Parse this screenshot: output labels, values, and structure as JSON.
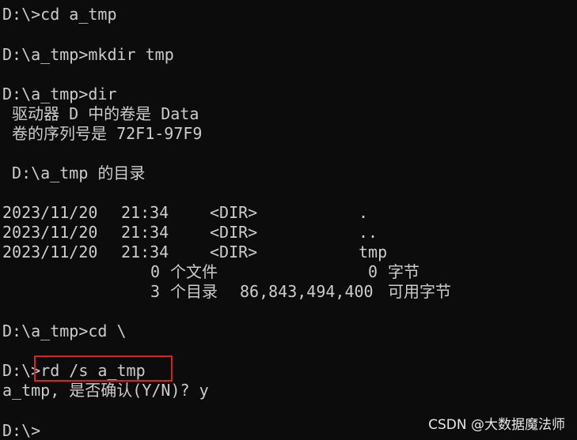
{
  "console": {
    "cmd1": "D:\\>cd a_tmp",
    "cmd2": "D:\\a_tmp>mkdir tmp",
    "cmd3": "D:\\a_tmp>dir",
    "volume_line": " 驱动器 D 中的卷是 Data",
    "serial_line": " 卷的序列号是 72F1-97F9",
    "dir_of_line": " D:\\a_tmp 的目录",
    "entries": [
      {
        "date": "2023/11/20",
        "time": "21:34",
        "type": "<DIR>",
        "name": "."
      },
      {
        "date": "2023/11/20",
        "time": "21:34",
        "type": "<DIR>",
        "name": ".."
      },
      {
        "date": "2023/11/20",
        "time": "21:34",
        "type": "<DIR>",
        "name": "tmp"
      }
    ],
    "files_summary": {
      "count": "0",
      "label": "个文件",
      "bytes": "0",
      "bytes_label": "字节"
    },
    "dirs_summary": {
      "count": "3",
      "label": "个目录",
      "bytes": "86,843,494,400",
      "bytes_label": "可用字节"
    },
    "cmd4": "D:\\a_tmp>cd \\",
    "prompt5": "D:\\>",
    "cmd5_text": "rd /s a_tmp",
    "confirm_line": "a_tmp, 是否确认(Y/N)? y",
    "final_prompt": "D:\\>"
  },
  "watermark": "CSDN @大数据魔法师",
  "colors": {
    "background": "#0c0c0c",
    "text": "#cccccc",
    "highlight": "#e02020"
  }
}
